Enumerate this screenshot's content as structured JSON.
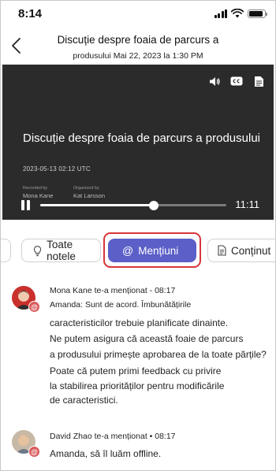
{
  "status_bar": {
    "time": "8:14"
  },
  "header": {
    "title_line1": "Discuție despre foaia de parcurs a",
    "title_line2": "produsului Mai 22, 2023 la 1:30 PM"
  },
  "video": {
    "title": "Discuție despre foaia de parcurs a produsului",
    "date": "2023-05-13 02:12 UTC",
    "recorded_by_label": "Recorded by",
    "recorded_by": "Mona Kane",
    "organized_by_label": "Organized by",
    "organized_by": "Kat Larsson",
    "duration": "11:11",
    "progress": 0.61,
    "controls": [
      "volume-icon",
      "captions-icon",
      "transcript-icon"
    ]
  },
  "filters": {
    "all_notes": "Toate notele",
    "mentions": "Mențiuni",
    "content": "Conținut",
    "active": "mentions",
    "accent_color": "#5b5fc7",
    "highlight_color": "#d7353a"
  },
  "feed": [
    {
      "meta": "Mona Kane te-a menționat - 08:17",
      "lines": [
        "Amanda: Sunt de acord. Îmbunătățirile",
        "caracteristicilor trebuie planificate dinainte.",
        "Ne putem asigura că această foaie de parcurs",
        "a produsului primește aprobarea de la toate părțile?",
        "Poate că putem primi feedback cu privire",
        "la stabilirea priorităților pentru modificările",
        "de caracteristici."
      ]
    },
    {
      "meta": "David Zhao te-a menționat • 08:17",
      "lines": [
        "Amanda, să îl luăm offline."
      ]
    }
  ]
}
